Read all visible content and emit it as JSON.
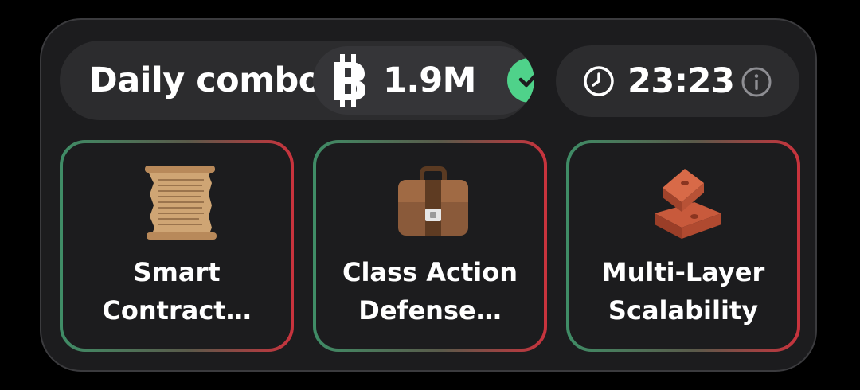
{
  "combo": {
    "label": "Daily combo",
    "reward": "1.9M",
    "reward_icon": "coin-icon",
    "status": "completed"
  },
  "timer": {
    "value": "23:23",
    "icon": "clock-icon",
    "info_icon": "info-icon"
  },
  "cards": [
    {
      "title": "Smart\nContract…",
      "icon": "scroll-icon"
    },
    {
      "title": "Class Action\nDefense…",
      "icon": "briefcase-icon"
    },
    {
      "title": "Multi-Layer\nScalability",
      "icon": "brick-icon"
    }
  ],
  "colors": {
    "background": "#000000",
    "panel": "#1c1c1e",
    "pill": "#2c2c2e",
    "accent_green": "#4fd28a",
    "card_border_green": "#3f8c66",
    "card_border_red": "#c8333d"
  }
}
